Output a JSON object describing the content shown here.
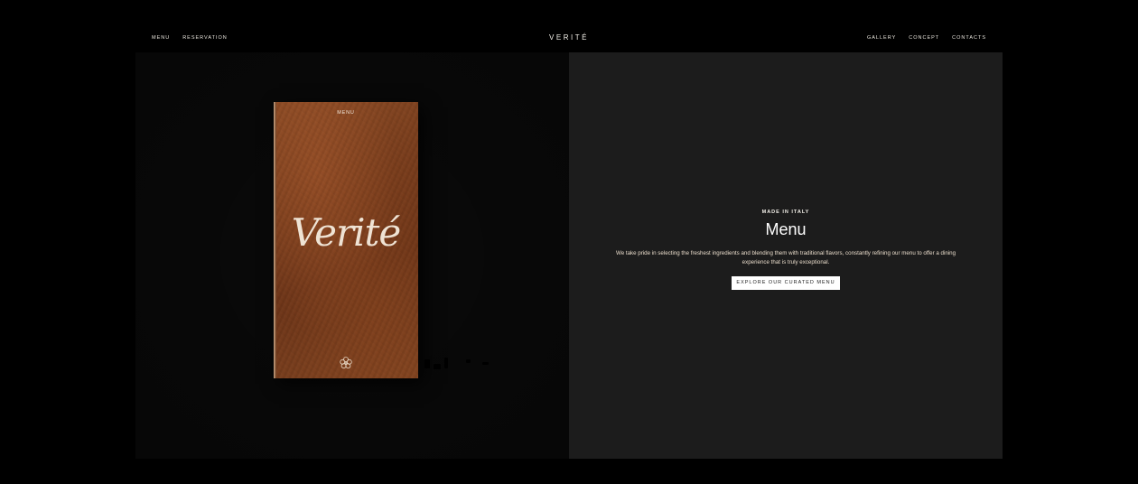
{
  "header": {
    "brand": "VERITÉ",
    "nav_left": [
      {
        "label": "MENU"
      },
      {
        "label": "RESERVATION"
      }
    ],
    "nav_right": [
      {
        "label": "GALLERY"
      },
      {
        "label": "CONCEPT"
      },
      {
        "label": "CONTACTS"
      }
    ]
  },
  "menu_book": {
    "top_label": "MENU",
    "script_title": "Verité",
    "emblem_icon": "flower-emblem-icon"
  },
  "section": {
    "kicker": "MADE IN ITALY",
    "title": "Menu",
    "description": "We take pride in selecting the freshest ingredients and blending them with traditional flavors, constantly refining our menu to offer a dining experience that is truly exceptional.",
    "cta_label": "EXPLORE OUR CURATED MENU"
  },
  "colors": {
    "page_background": "#000000",
    "left_panel": "#0a0a0a",
    "right_panel": "#1c1c1c",
    "leather": "#7a3d1c",
    "button_bg": "#ffffff"
  }
}
